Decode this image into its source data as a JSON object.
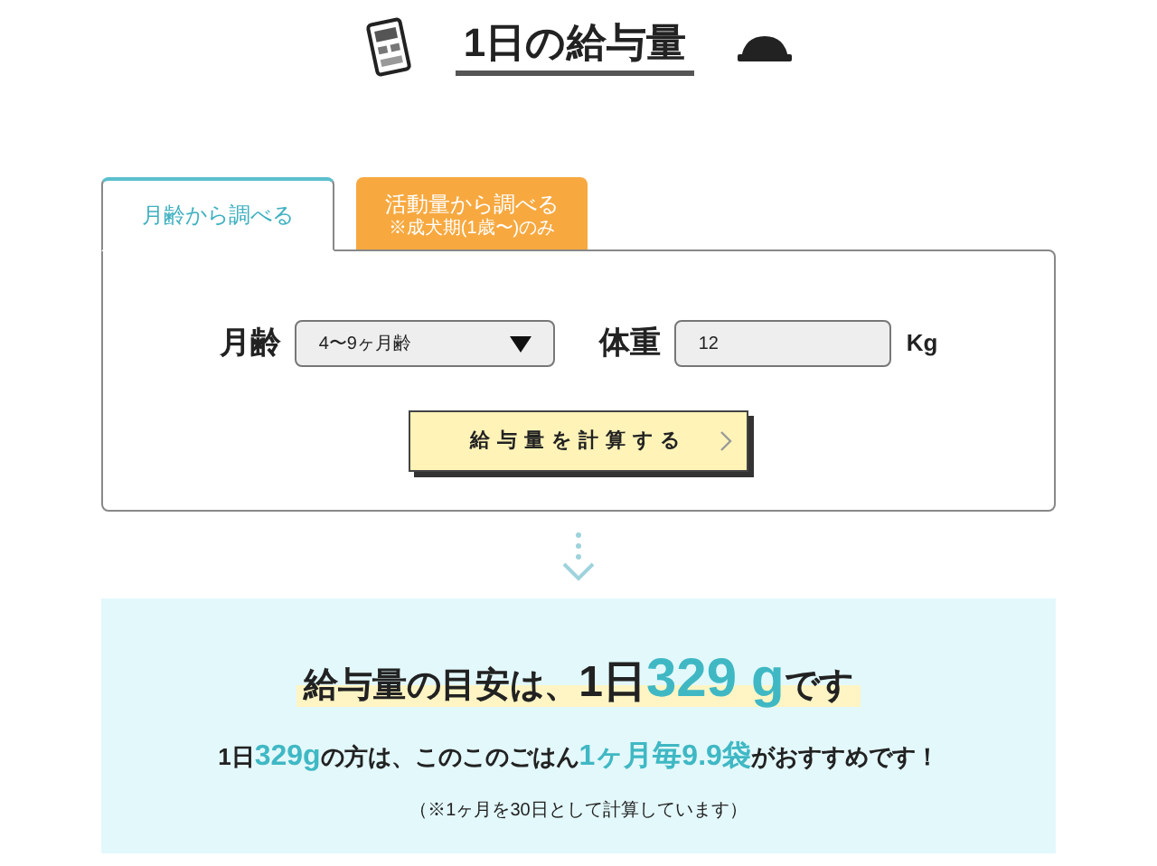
{
  "title": "1日の給与量",
  "tabs": [
    {
      "label": "月齢から調べる",
      "selected": true
    },
    {
      "label": "活動量から調べる",
      "note": "※成犬期(1歳〜)のみ",
      "selected": false
    }
  ],
  "form": {
    "age_label": "月齢",
    "age_value": "4〜9ヶ月齢",
    "weight_label": "体重",
    "weight_value": "12",
    "weight_unit": "Kg",
    "button": "給与量を計算する"
  },
  "result": {
    "headline": [
      {
        "text": "給与量の目安は、",
        "accent": false
      },
      {
        "text": "1日",
        "accent": false
      },
      {
        "text": "329",
        "accent": true
      },
      {
        "text": "g",
        "accent": true
      },
      {
        "text": "です",
        "accent": false
      }
    ],
    "recommendation": [
      {
        "text": "1日",
        "accent": false
      },
      {
        "text": "329g",
        "accent": true
      },
      {
        "text": "の方は、このこのごはん",
        "accent": false
      },
      {
        "text": "1ヶ月毎9.9袋",
        "accent": true
      },
      {
        "text": "がおすすめです！",
        "accent": false
      }
    ],
    "note": "（※1ヶ月を30日として計算しています）"
  }
}
